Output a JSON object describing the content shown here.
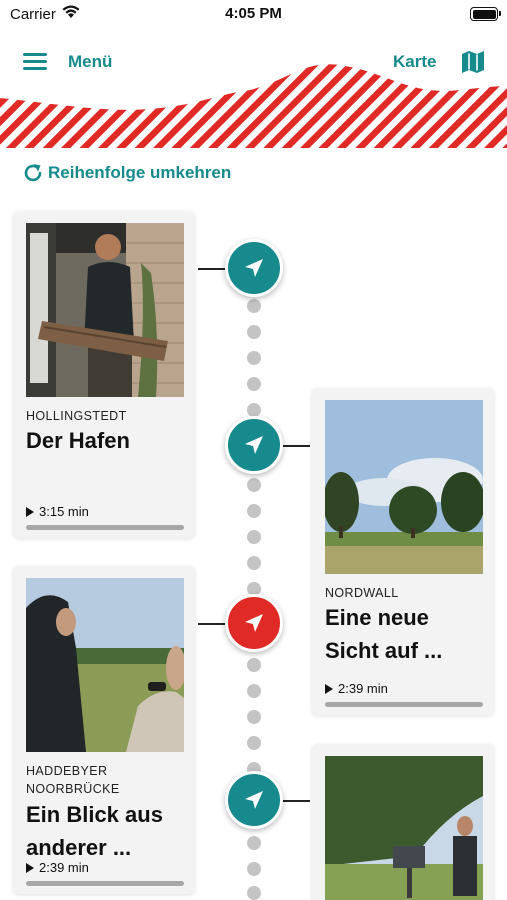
{
  "status_bar": {
    "carrier": "Carrier",
    "time": "4:05 PM"
  },
  "nav": {
    "menu_label": "Menü",
    "map_label": "Karte"
  },
  "reverse_order_label": "Reihenfolge umkehren",
  "colors": {
    "accent": "#168a8c",
    "active_pin": "#e02a26",
    "hatch": "#e02a26"
  },
  "stations": [
    {
      "place": "HOLLINGSTEDT",
      "title": "Der Hafen",
      "duration": "3:15 min",
      "pin_state": "default",
      "icon": "navigation-arrow-icon"
    },
    {
      "place": "NORDWALL",
      "title": "Eine neue Sicht auf ...",
      "duration": "2:39 min",
      "pin_state": "default",
      "icon": "navigation-arrow-icon"
    },
    {
      "place": "HADDEBYER NOORBRÜCKE",
      "title": "Ein Blick aus anderer ...",
      "duration": "2:39 min",
      "pin_state": "active",
      "icon": "navigation-arrow-icon"
    },
    {
      "place": "",
      "title": "",
      "duration": "",
      "pin_state": "default",
      "icon": "navigation-arrow-icon"
    }
  ]
}
